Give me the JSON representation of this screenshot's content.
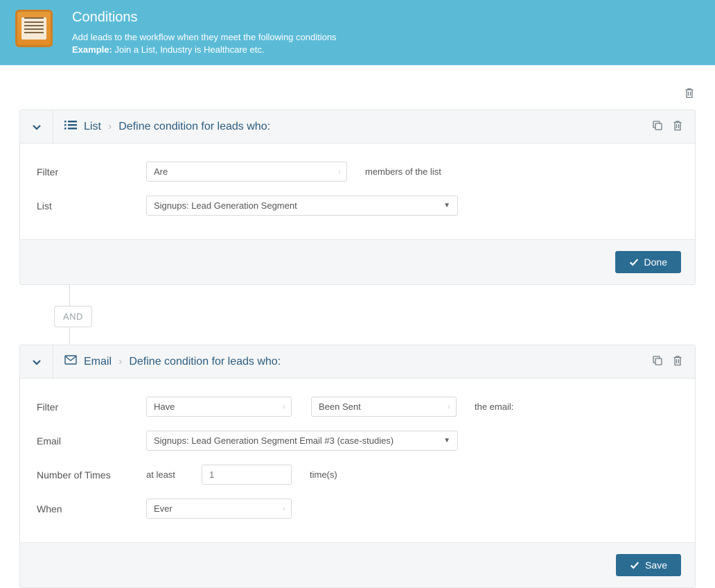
{
  "header": {
    "title": "Conditions",
    "subtitle": "Add leads to the workflow when they meet the following conditions",
    "example_label": "Example:",
    "example_text": "Join a List, Industry is Healthcare etc."
  },
  "connector_label": "AND",
  "card1": {
    "type_label": "List",
    "breadcrumb": "Define condition for leads who:",
    "filter_label": "Filter",
    "filter_value": "Are",
    "filter_suffix": "members of the list",
    "list_label": "List",
    "list_value": "Signups: Lead Generation Segment",
    "done_label": "Done"
  },
  "card2": {
    "type_label": "Email",
    "breadcrumb": "Define condition for leads who:",
    "filter_label": "Filter",
    "filter_value": "Have",
    "filter_action": "Been Sent",
    "filter_suffix": "the email:",
    "email_label": "Email",
    "email_value": "Signups: Lead Generation Segment Email #3 (case-studies)",
    "times_label": "Number of Times",
    "times_qualifier": "at least",
    "times_value": "1",
    "times_suffix": "time(s)",
    "when_label": "When",
    "when_value": "Ever",
    "save_label": "Save"
  }
}
